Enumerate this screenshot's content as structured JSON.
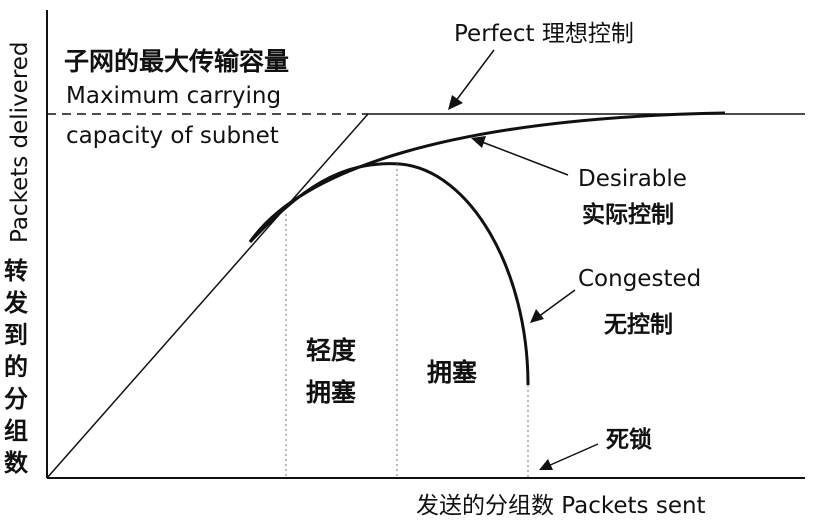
{
  "labels": {
    "max_capacity_cn": "子网的最大传输容量",
    "max_capacity_en_1": "Maximum carrying",
    "max_capacity_en_2": "capacity of subnet",
    "perfect": "Perfect 理想控制",
    "desirable_en": "Desirable",
    "desirable_cn": "实际控制",
    "congested_en": "Congested",
    "congested_cn": "无控制",
    "deadlock_cn": "死锁",
    "light_congestion_1": "轻度",
    "light_congestion_2": "拥塞",
    "congestion": "拥塞",
    "y_axis_en": "Packets delivered",
    "y_axis_cn": [
      "转",
      "发",
      "到",
      "的",
      "分",
      "组",
      "数"
    ],
    "x_axis": "发送的分组数 Packets sent"
  },
  "colors": {
    "ink": "#111111",
    "guide": "#777777"
  }
}
